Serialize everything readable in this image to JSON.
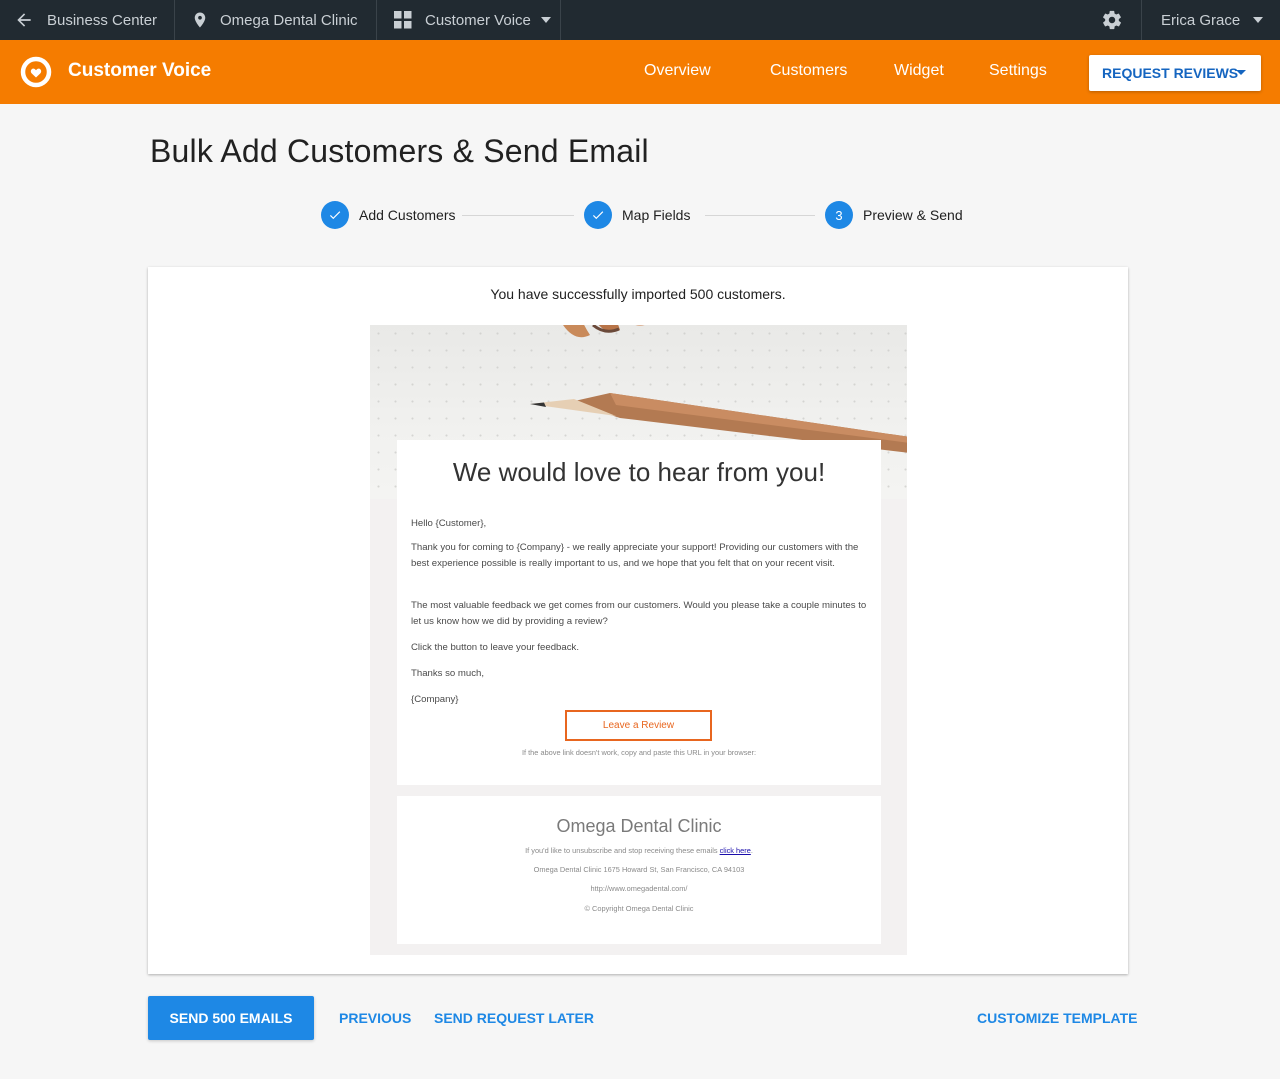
{
  "topbar": {
    "back_label": "Business Center",
    "location_label": "Omega Dental Clinic",
    "product_label": "Customer Voice",
    "user_name": "Erica Grace"
  },
  "navbar": {
    "app_title": "Customer Voice",
    "links": [
      "Overview",
      "Customers",
      "Widget",
      "Settings"
    ],
    "request_button": "REQUEST REVIEWS",
    "accent_color": "#f57c00"
  },
  "page": {
    "title": "Bulk Add Customers & Send Email"
  },
  "stepper": {
    "steps": [
      {
        "label": "Add Customers",
        "state": "done"
      },
      {
        "label": "Map Fields",
        "state": "done"
      },
      {
        "label": "Preview & Send",
        "number": "3",
        "state": "active"
      }
    ]
  },
  "card": {
    "import_message": "You have successfully imported 500 customers."
  },
  "email": {
    "headline": "We would love to hear from you!",
    "greeting": "Hello {Customer},",
    "para1": "Thank you for coming to {Company} - we really appreciate your support! Providing our customers with the best experience possible is really important to us, and we hope that you felt that on your recent visit.",
    "para2": "The most valuable feedback we get comes from our customers. Would you please take a couple minutes to let us know how we did by providing a review?",
    "para3": "Click the button to leave your feedback.",
    "signoff": "Thanks so much,",
    "signature": "{Company}",
    "button_label": "Leave a Review",
    "copy_note": "If the above link doesn't work, copy and paste this URL in your browser:",
    "footer": {
      "company": "Omega Dental Clinic",
      "unsubscribe_text": "If you'd like to unsubscribe and stop receiving these emails",
      "unsubscribe_link": "click here",
      "address": "Omega Dental Clinic  1675 Howard St, San Francisco, CA 94103",
      "website": "http://www.omegadental.com/",
      "copyright": "© Copyright Omega Dental Clinic"
    }
  },
  "actions": {
    "send_label": "SEND 500 EMAILS",
    "previous_label": "PREVIOUS",
    "later_label": "SEND REQUEST LATER",
    "customize_label": "CUSTOMIZE TEMPLATE"
  }
}
